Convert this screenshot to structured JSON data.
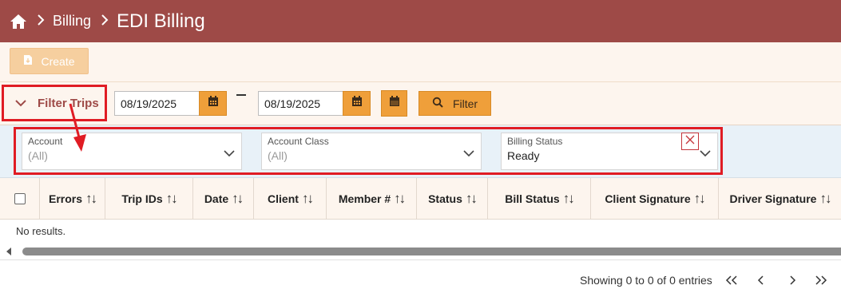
{
  "header": {
    "home_icon": "home-icon",
    "breadcrumb": [
      "Billing"
    ],
    "title": "EDI Billing",
    "bg_color": "#9e4a47"
  },
  "toolbar": {
    "create_label": "Create",
    "create_icon": "file-download-icon"
  },
  "filter_bar": {
    "toggle_label": "Filter Trips",
    "toggle_icon": "chevron-down-icon",
    "start_date": "08/19/2025",
    "end_date": "08/19/2025",
    "date_separator": "–",
    "filter_label": "Filter",
    "accent_color": "#ef9f3a"
  },
  "filters": {
    "account": {
      "label": "Account",
      "value": "(All)"
    },
    "account_class": {
      "label": "Account Class",
      "value": "(All)"
    },
    "billing_status": {
      "label": "Billing Status",
      "value": "Ready"
    }
  },
  "table": {
    "columns": [
      "Errors",
      "Trip IDs",
      "Date",
      "Client",
      "Member #",
      "Status",
      "Bill Status",
      "Client Signature",
      "Driver Signature"
    ],
    "empty_text": "No results."
  },
  "pagination": {
    "summary": "Showing 0 to 0 of 0 entries",
    "first_icon": "double-chevron-left-icon",
    "prev_icon": "chevron-left-icon",
    "next_icon": "chevron-right-icon",
    "last_icon": "double-chevron-right-icon"
  },
  "annotation_color": "#e01c24"
}
